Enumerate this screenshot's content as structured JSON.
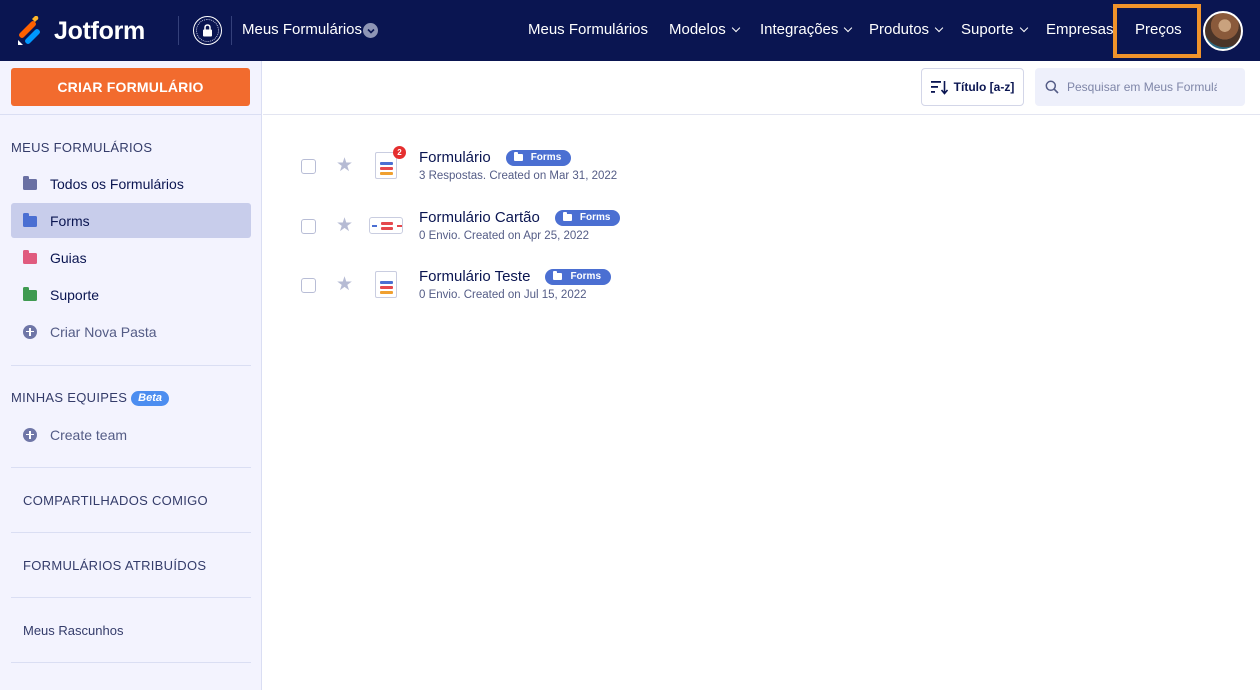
{
  "header": {
    "brand": "Jotform",
    "workspace_title": "Meus Formulários",
    "nav": [
      {
        "label": "Meus Formulários",
        "has_dropdown": false
      },
      {
        "label": "Modelos",
        "has_dropdown": true
      },
      {
        "label": "Integrações",
        "has_dropdown": true
      },
      {
        "label": "Produtos",
        "has_dropdown": true
      },
      {
        "label": "Suporte",
        "has_dropdown": true
      },
      {
        "label": "Empresas",
        "has_dropdown": false
      }
    ],
    "pricing_label": "Preços",
    "highlight_color": "#f0932b",
    "bg_color": "#0a1551"
  },
  "sidebar": {
    "create_button": "CRIAR FORMULÁRIO",
    "my_forms_heading": "MEUS FORMULÁRIOS",
    "folders": [
      {
        "label": "Todos os Formulários",
        "color": "#6a70a3",
        "active": false
      },
      {
        "label": "Forms",
        "color": "#4b6fd2",
        "active": true
      },
      {
        "label": "Guias",
        "color": "#e05b7f",
        "active": false
      },
      {
        "label": "Suporte",
        "color": "#3f9a51",
        "active": false
      }
    ],
    "new_folder": "Criar Nova Pasta",
    "teams_heading": "MINHAS EQUIPES",
    "teams_badge": "Beta",
    "create_team": "Create team",
    "shared": "COMPARTILHADOS COMIGO",
    "assigned": "FORMULÁRIOS ATRIBUÍDOS",
    "drafts": "Meus Rascunhos"
  },
  "toolbar": {
    "sort_label": "Título [a-z]",
    "search_placeholder": "Pesquisar em Meus Formulários"
  },
  "forms": [
    {
      "title": "Formulário",
      "tag": "Forms",
      "meta": "3 Respostas. Created on Mar 31, 2022",
      "badge": "2",
      "icon": "form-icon"
    },
    {
      "title": "Formulário Cartão",
      "tag": "Forms",
      "meta": "0 Envio. Created on Apr 25, 2022",
      "badge": "",
      "icon": "card-form-icon"
    },
    {
      "title": "Formulário Teste",
      "tag": "Forms",
      "meta": "0 Envio. Created on Jul 15, 2022",
      "badge": "",
      "icon": "form-icon"
    }
  ]
}
